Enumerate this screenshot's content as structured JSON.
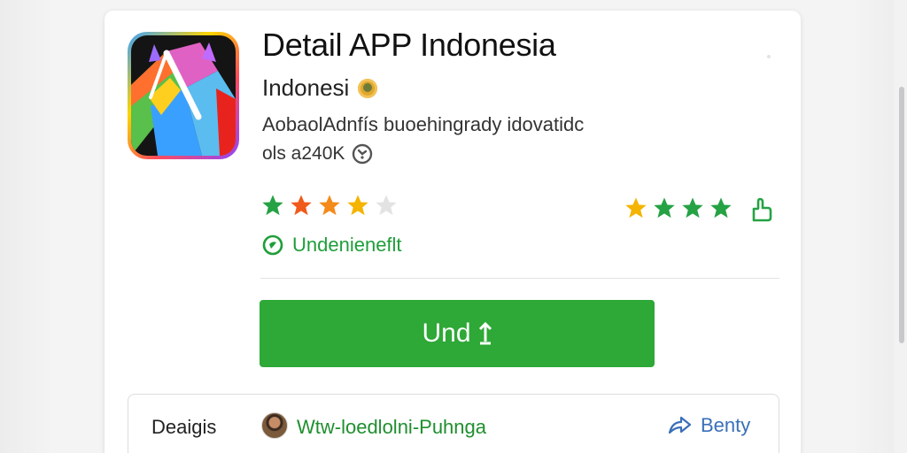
{
  "app": {
    "title": "Detail APP Indonesia",
    "developer": "Indonesi",
    "description": "AobaolAdnfís buoehingrady idovatidc",
    "meta": "ols a240K",
    "verified_label": "Undenieneflt"
  },
  "ratings": {
    "left_stars": 4,
    "right_stars": 4
  },
  "install_button": {
    "label": "Und"
  },
  "details": {
    "label": "Deaigis",
    "developer_link": "Wtw-loedlolni-Puhnga",
    "share_label": "Benty"
  },
  "colors": {
    "accent_green": "#2ea836",
    "link_green": "#1f8f2e",
    "share_blue": "#3a6fb8",
    "star_gold": "#f4b400",
    "star_orange": "#f05a1a",
    "star_green": "#25a244",
    "star_empty": "#e3e3e3"
  },
  "icons": {
    "app_icon": "app-logo-icon",
    "developer_badge": "coin-badge-icon",
    "meta_icon": "clock-icon",
    "thumb": "thumbs-up-icon",
    "verified": "verified-check-icon",
    "install": "download-icon",
    "share": "share-icon"
  }
}
